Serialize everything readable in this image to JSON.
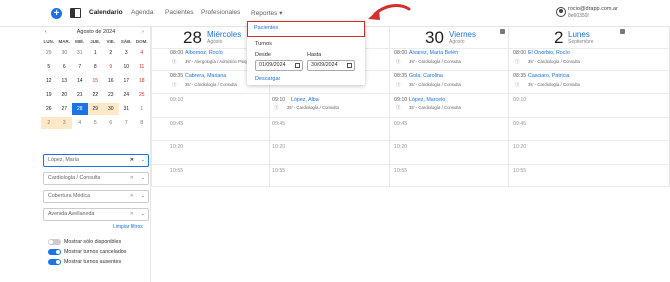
{
  "topbar": {
    "nav": [
      "Calendario",
      "Agenda",
      "Pacientes",
      "Profesionales",
      "Reportes"
    ],
    "user_email": "rocio@drapp.com.ar",
    "user_id": "8e60350l"
  },
  "calendar": {
    "month": "Agosto de 2024",
    "dow": [
      "LUN.",
      "MAR.",
      "MIÉ.",
      "JUE.",
      "VIE.",
      "SÁB.",
      "DOM."
    ],
    "weeks": [
      [
        "29",
        "30",
        "31",
        "1",
        "2",
        "3",
        "4"
      ],
      [
        "5",
        "6",
        "7",
        "8",
        "9",
        "10",
        "11"
      ],
      [
        "12",
        "13",
        "14",
        "15",
        "16",
        "17",
        "18"
      ],
      [
        "19",
        "20",
        "21",
        "22",
        "23",
        "24",
        "25"
      ],
      [
        "26",
        "27",
        "28",
        "29",
        "30",
        "31",
        "1"
      ],
      [
        "2",
        "3",
        "4",
        "5",
        "6",
        "7",
        "8"
      ]
    ]
  },
  "filters": {
    "professional": "López, María",
    "specialty": "Cardiología / Consulta",
    "coverage": "Cobertura Médica",
    "location": "Avenida Avellaneda",
    "clear": "Limpiar filtros"
  },
  "toggles": [
    {
      "label": "Mostrar sólo disponibles",
      "on": false
    },
    {
      "label": "Mostrar turnos cancelados",
      "on": true
    },
    {
      "label": "Mostrar turnos ausentes",
      "on": true
    }
  ],
  "days": [
    {
      "num": "28",
      "name": "Miércoles",
      "month": "Agosto"
    },
    {
      "num": "30",
      "name": "Viernes",
      "month": "Agosto"
    },
    {
      "num": "2",
      "name": "Lunes",
      "month": "Septiembre"
    }
  ],
  "slots": [
    "09:10",
    "09:45",
    "10:20",
    "10:55"
  ],
  "events": {
    "col1": [
      {
        "time": "08:00",
        "name": "Albornoz, Rocío",
        "info": "35' - Alergología / Admisión Psiquiátrica"
      },
      {
        "time": "08:35",
        "name": "Cabrera, Mariana",
        "info": "35' - Cardiología / Consulta"
      }
    ],
    "col2": [
      {
        "time": "09:10",
        "name": "López, Alba",
        "info": "35' - Cardiología / Consulta"
      }
    ],
    "col3": [
      {
        "time": "08:00",
        "name": "Álvarez, María Belén",
        "info": "35' - Cardiología / Consulta"
      },
      {
        "time": "08:35",
        "name": "Gola, Carolina",
        "info": "35' - Cardiología / Consulta"
      },
      {
        "time": "09:10",
        "name": "López, Marcelo",
        "info": "35' - Cardiología / Consulta"
      }
    ],
    "col4": [
      {
        "time": "08:00",
        "name": "El Onorbio, Rocío",
        "info": "35' - Cardiología / Consulta"
      },
      {
        "time": "08:35",
        "name": "Casciaro, Patricia",
        "info": "35' - Cardiología / Consulta"
      }
    ]
  },
  "dropdown": {
    "pacientes": "Pacientes",
    "turnos": "Turnos",
    "desde_label": "Desde",
    "hasta_label": "Hasta",
    "desde": "01/09/2024",
    "hasta": "30/09/2024",
    "descargar": "Descargar"
  },
  "colors": {
    "accent": "#1a73e8",
    "highlight": "#d32f2f"
  }
}
